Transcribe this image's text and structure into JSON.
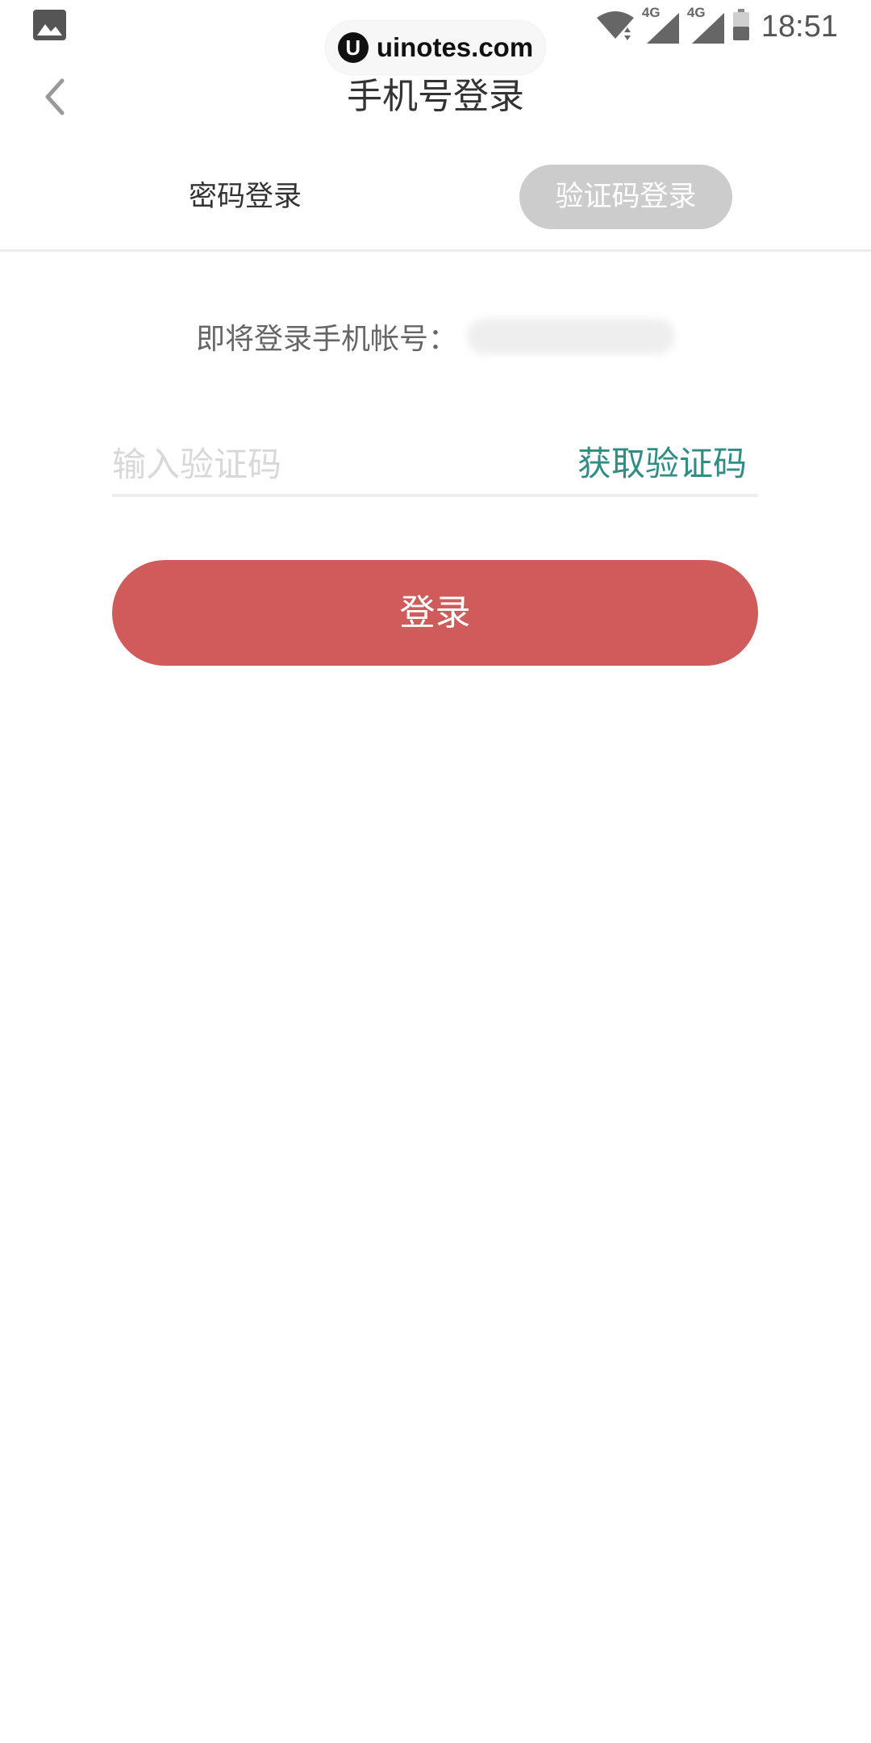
{
  "status_bar": {
    "time": "18:51",
    "network_1": "4G",
    "network_2": "4G",
    "icons": [
      "gallery-icon",
      "wifi-icon",
      "signal-icon",
      "signal-icon",
      "battery-icon"
    ]
  },
  "watermark": {
    "logo_letter": "U",
    "text": "uinotes.com"
  },
  "header": {
    "title": "手机号登录",
    "back_icon": "chevron-left-icon"
  },
  "tabs": [
    {
      "label": "密码登录",
      "active": false
    },
    {
      "label": "验证码登录",
      "active": true
    }
  ],
  "account": {
    "label": "即将登录手机帐号："
  },
  "code_input": {
    "value": "",
    "placeholder": "输入验证码",
    "get_code_label": "获取验证码"
  },
  "login_button": {
    "label": "登录"
  },
  "colors": {
    "accent_red": "#d05b5b",
    "link_green": "#2f8d83",
    "tab_active_bg": "#cccccc",
    "divider": "#ececec"
  }
}
